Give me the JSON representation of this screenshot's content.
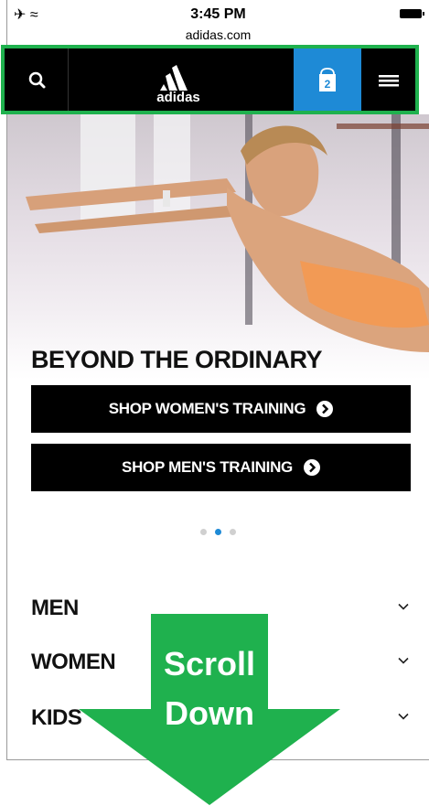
{
  "status_bar": {
    "time": "3:45 PM",
    "url": "adidas.com",
    "signal_icons": "✈ ≈"
  },
  "nav": {
    "logo_text": "adidas",
    "bag_count": "2",
    "icons": [
      "search-icon",
      "adidas-logo",
      "shopping-bag-icon",
      "hamburger-menu-icon"
    ]
  },
  "hero": {
    "title": "BEYOND THE ORDINARY",
    "cta_women": "SHOP WOMEN'S TRAINING",
    "cta_men": "SHOP MEN'S TRAINING",
    "slides": 3,
    "active_slide": 2
  },
  "categories": {
    "items": [
      "MEN",
      "WOMEN",
      "KIDS"
    ]
  },
  "overlay": {
    "line1": "Scroll",
    "line2": "Down"
  },
  "colors": {
    "nav_bg": "#000000",
    "bag_bg": "#1e8ad6",
    "highlight": "#1fb14e",
    "dot_active": "#1e8ad6"
  }
}
